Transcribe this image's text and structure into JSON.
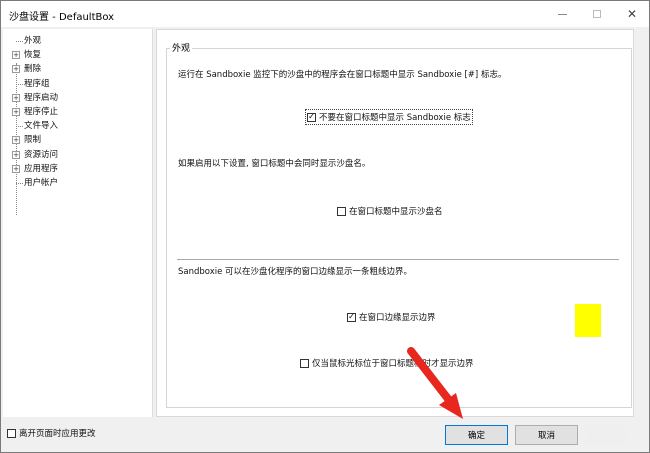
{
  "window": {
    "title": "沙盘设置 - DefaultBox"
  },
  "tree": {
    "items": [
      {
        "label": "外观",
        "expandable": false
      },
      {
        "label": "恢复",
        "expandable": true
      },
      {
        "label": "删除",
        "expandable": true
      },
      {
        "label": "程序组",
        "expandable": false
      },
      {
        "label": "程序启动",
        "expandable": true
      },
      {
        "label": "程序停止",
        "expandable": true
      },
      {
        "label": "文件导入",
        "expandable": false
      },
      {
        "label": "限制",
        "expandable": true
      },
      {
        "label": "资源访问",
        "expandable": true
      },
      {
        "label": "应用程序",
        "expandable": true
      },
      {
        "label": "用户帐户",
        "expandable": false
      }
    ]
  },
  "panel": {
    "group_title": "外观",
    "desc1": "运行在 Sandboxie 监控下的沙盘中的程序会在窗口标题中显示 Sandboxie [#] 标志。",
    "check_no_title_mark": "不要在窗口标题中显示 Sandboxie 标志",
    "desc2": "如果启用以下设置, 窗口标题中会同时显示沙盘名。",
    "check_show_box_name": "在窗口标题中显示沙盘名",
    "desc3": "Sandboxie 可以在沙盘化程序的窗口边缘显示一条粗线边界。",
    "check_show_border": "在窗口边缘显示边界",
    "check_border_on_hover": "仅当鼠标光标位于窗口标题栏时才显示边界"
  },
  "checkbox_states": {
    "no_title_mark": true,
    "show_box_name": false,
    "show_border": true,
    "border_on_hover": false,
    "apply_on_leave": false
  },
  "border_color": "#ffff00",
  "footer": {
    "apply_on_leave_label": "离开页面时应用更改",
    "ok_label": "确定",
    "cancel_label": "取消"
  },
  "annotation_arrow_color": "#e8281e"
}
